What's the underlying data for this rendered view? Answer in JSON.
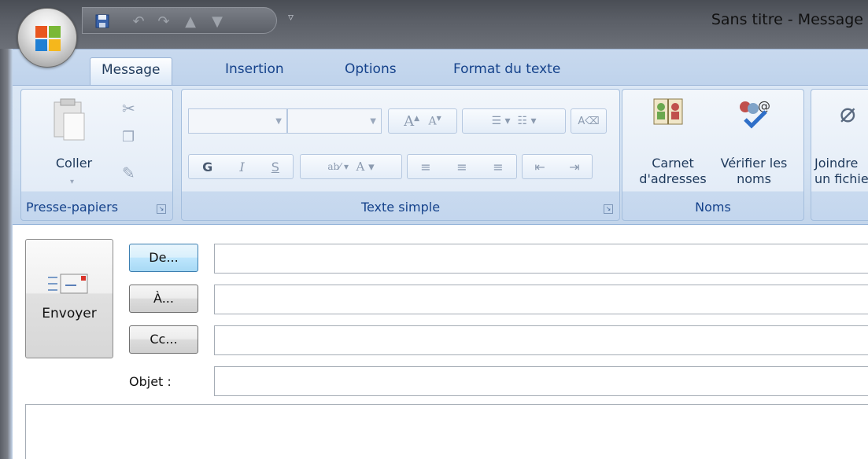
{
  "window": {
    "title": "Sans titre - Message"
  },
  "quick_access": {
    "items": [
      "save-icon",
      "undo-icon",
      "redo-icon",
      "up-arrow-icon",
      "down-arrow-icon",
      "customize-icon"
    ]
  },
  "tabs": [
    {
      "label": "Message",
      "active": true
    },
    {
      "label": "Insertion",
      "active": false
    },
    {
      "label": "Options",
      "active": false
    },
    {
      "label": "Format du texte",
      "active": false
    }
  ],
  "groups": {
    "clipboard": {
      "label": "Presse-papiers",
      "paste_label": "Coller"
    },
    "basic_text": {
      "label": "Texte simple",
      "bold": "G",
      "italic": "I",
      "underline": "S"
    },
    "names": {
      "label": "Noms",
      "address_book": "Carnet d'adresses",
      "check_names": "Vérifier les noms"
    },
    "include": {
      "attach_line1": "Joindre",
      "attach_line2": "un fichier"
    }
  },
  "header": {
    "send_label": "Envoyer",
    "from_label": "De...",
    "to_label": "À...",
    "cc_label": "Cc...",
    "subject_label": "Objet :",
    "from_value": "",
    "to_value": "",
    "cc_value": "",
    "subject_value": ""
  },
  "colors": {
    "ribbon_bg": "#d2e1f2",
    "titlebar": "#5a5e66",
    "accent": "#15428b"
  }
}
